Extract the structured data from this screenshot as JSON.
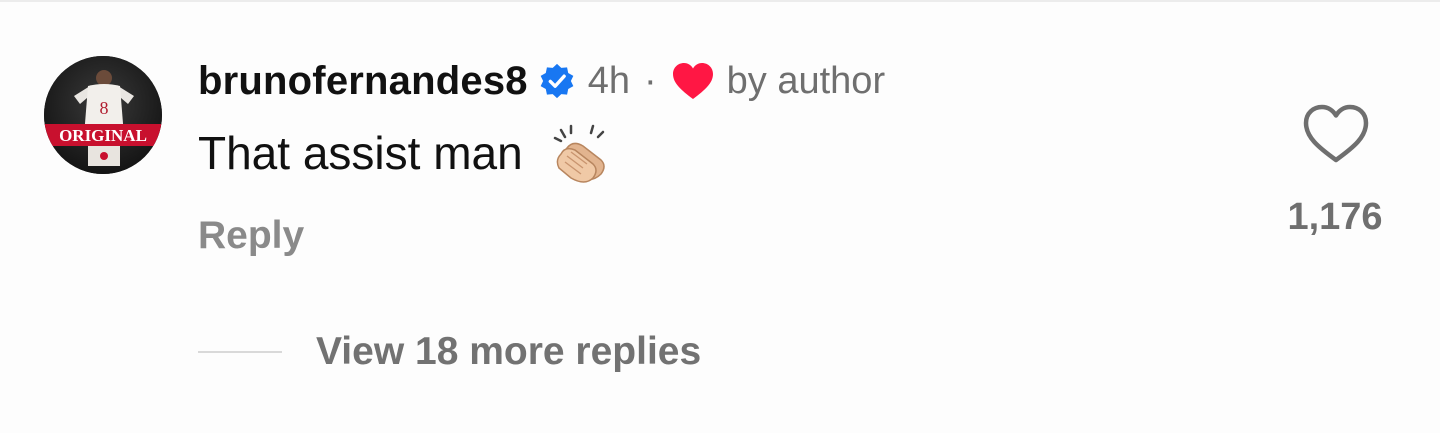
{
  "comment": {
    "username": "brunofernandes8",
    "timestamp": "4h",
    "separator": "·",
    "liked_by_author_label": "by author",
    "text": "That assist man",
    "emoji_icon": "clapping-hands-icon",
    "reply_label": "Reply",
    "like_count": "1,176",
    "view_replies_label": "View 18 more replies",
    "avatar": {
      "jersey_number": "8",
      "banner_text": "ORIGINAL"
    }
  },
  "icons": {
    "verified": "verified-badge-icon",
    "liked": "heart-filled-icon",
    "like_action": "heart-outline-icon"
  },
  "colors": {
    "verified_blue": "#1877f2",
    "heart_red": "#ff1744",
    "muted_text": "#6f6f6f",
    "primary_text": "#111111"
  }
}
